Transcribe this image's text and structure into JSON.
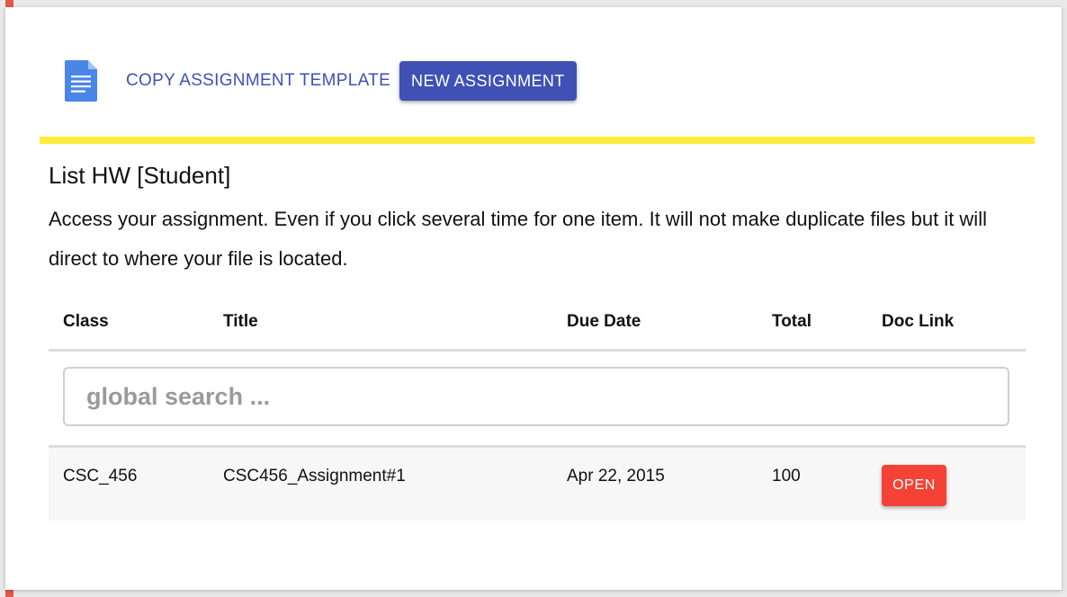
{
  "colors": {
    "accent_bar": "#e05a47",
    "link_blue": "#3f51b5",
    "primary_button": "#3f51b5",
    "yellow_rule": "#ffeb3b",
    "open_button": "#f44336",
    "doc_icon": "#4a86e8"
  },
  "toolbar": {
    "doc_icon": "google-doc-icon",
    "copy_label": "COPY ASSIGNMENT TEMPLATE",
    "new_label": "NEW ASSIGNMENT"
  },
  "section": {
    "title": "List HW [Student]",
    "description": "Access your assignment. Even if you click several time for one item. It will not make duplicate files but it will direct to where your file is located."
  },
  "table": {
    "headers": {
      "class": "Class",
      "title": "Title",
      "due_date": "Due Date",
      "total": "Total",
      "doc_link": "Doc Link"
    },
    "search": {
      "placeholder": "global search ...",
      "value": ""
    },
    "rows": [
      {
        "class": "CSC_456",
        "title": "CSC456_Assignment#1",
        "due_date": "Apr 22, 2015",
        "total": "100",
        "doc_link_label": "OPEN"
      }
    ]
  }
}
